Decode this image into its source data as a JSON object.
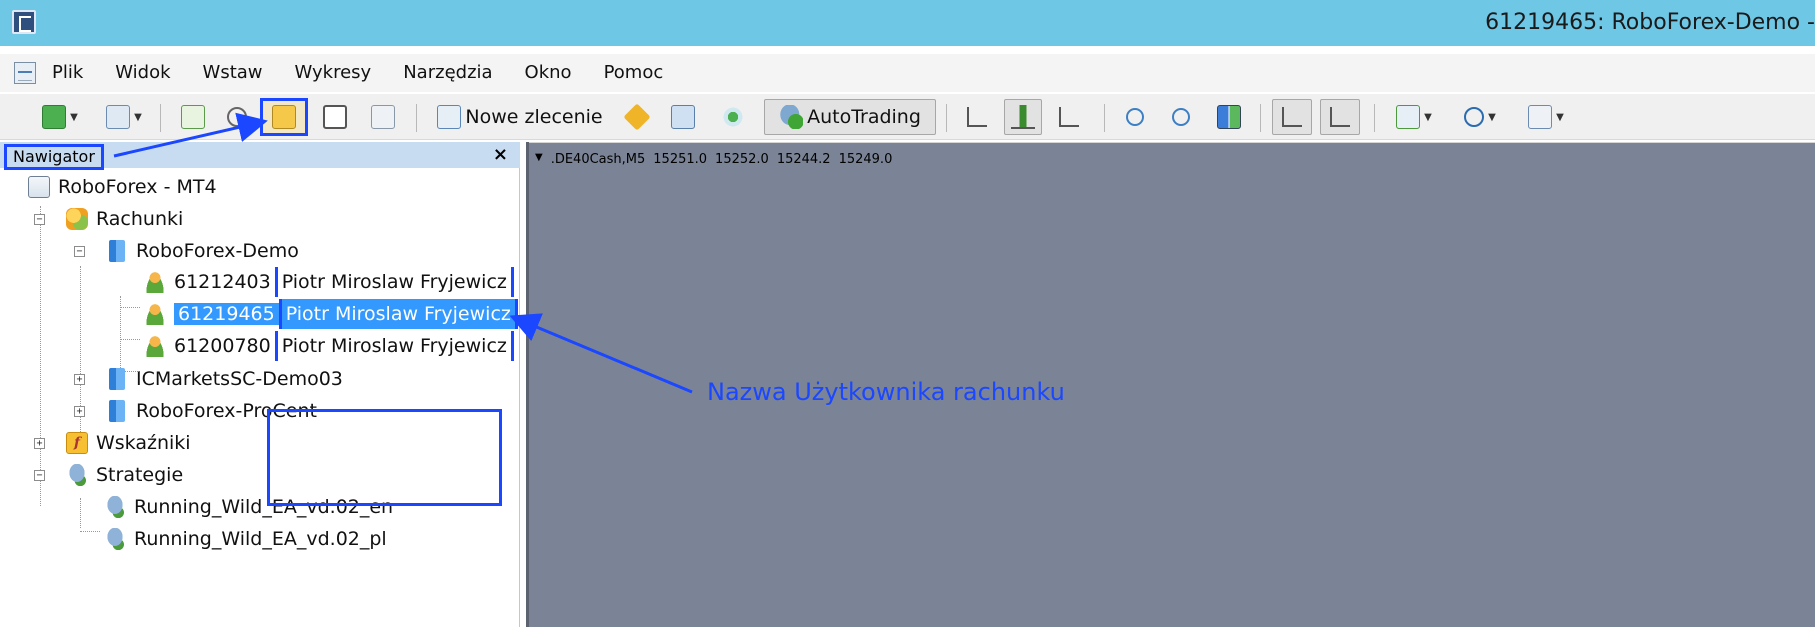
{
  "window": {
    "title": "61219465: RoboForex-Demo -"
  },
  "menu": [
    "Plik",
    "Widok",
    "Wstaw",
    "Wykresy",
    "Narzędzia",
    "Okno",
    "Pomoc"
  ],
  "toolbar": {
    "new_order_label": "Nowe zlecenie",
    "autotrading_label": "AutoTrading",
    "icons": [
      "new-chart-icon",
      "profiles-icon",
      "market-watch-icon",
      "crosshair-icon",
      "navigator-icon",
      "terminal-icon",
      "strategy-tester-icon",
      "new-order-icon",
      "metaeditor-icon",
      "history-center-icon",
      "signals-icon",
      "autotrading-icon",
      "bar-chart-icon",
      "candlestick-icon",
      "line-chart-icon",
      "zoom-in-icon",
      "zoom-out-icon",
      "tile-windows-icon",
      "autoscroll-icon",
      "chart-shift-icon",
      "indicators-icon",
      "periods-icon",
      "templates-icon"
    ]
  },
  "navigator": {
    "title": "Nawigator",
    "close": "×",
    "root": "RoboForex - MT4",
    "accounts_label": "Rachunki",
    "servers": [
      "RoboForex-Demo",
      "ICMarketsSC-Demo03",
      "RoboForex-ProCent"
    ],
    "accounts": [
      {
        "number": "61212403",
        "name": "Piotr Miroslaw Fryjewicz"
      },
      {
        "number": "61219465",
        "name": "Piotr Miroslaw Fryjewicz"
      },
      {
        "number": "61200780",
        "name": "Piotr Miroslaw Fryjewicz"
      }
    ],
    "indicators_label": "Wskaźniki",
    "strategies_label": "Strategie",
    "strategies": [
      "Running_Wild_EA_vd.02_en",
      "Running_Wild_EA_vd.02_pl"
    ]
  },
  "chart": {
    "symbol": ".DE40Cash,M5",
    "open": "15251.0",
    "high": "15252.0",
    "low": "15244.2",
    "close": "15249.0"
  },
  "annotation": {
    "text": "Nazwa Użytkownika rachunku"
  },
  "colors": {
    "annotation": "#1a47ff",
    "chart_bg": "#7b8496",
    "titlebar": "#6fc7e6",
    "selection": "#3399ff"
  }
}
